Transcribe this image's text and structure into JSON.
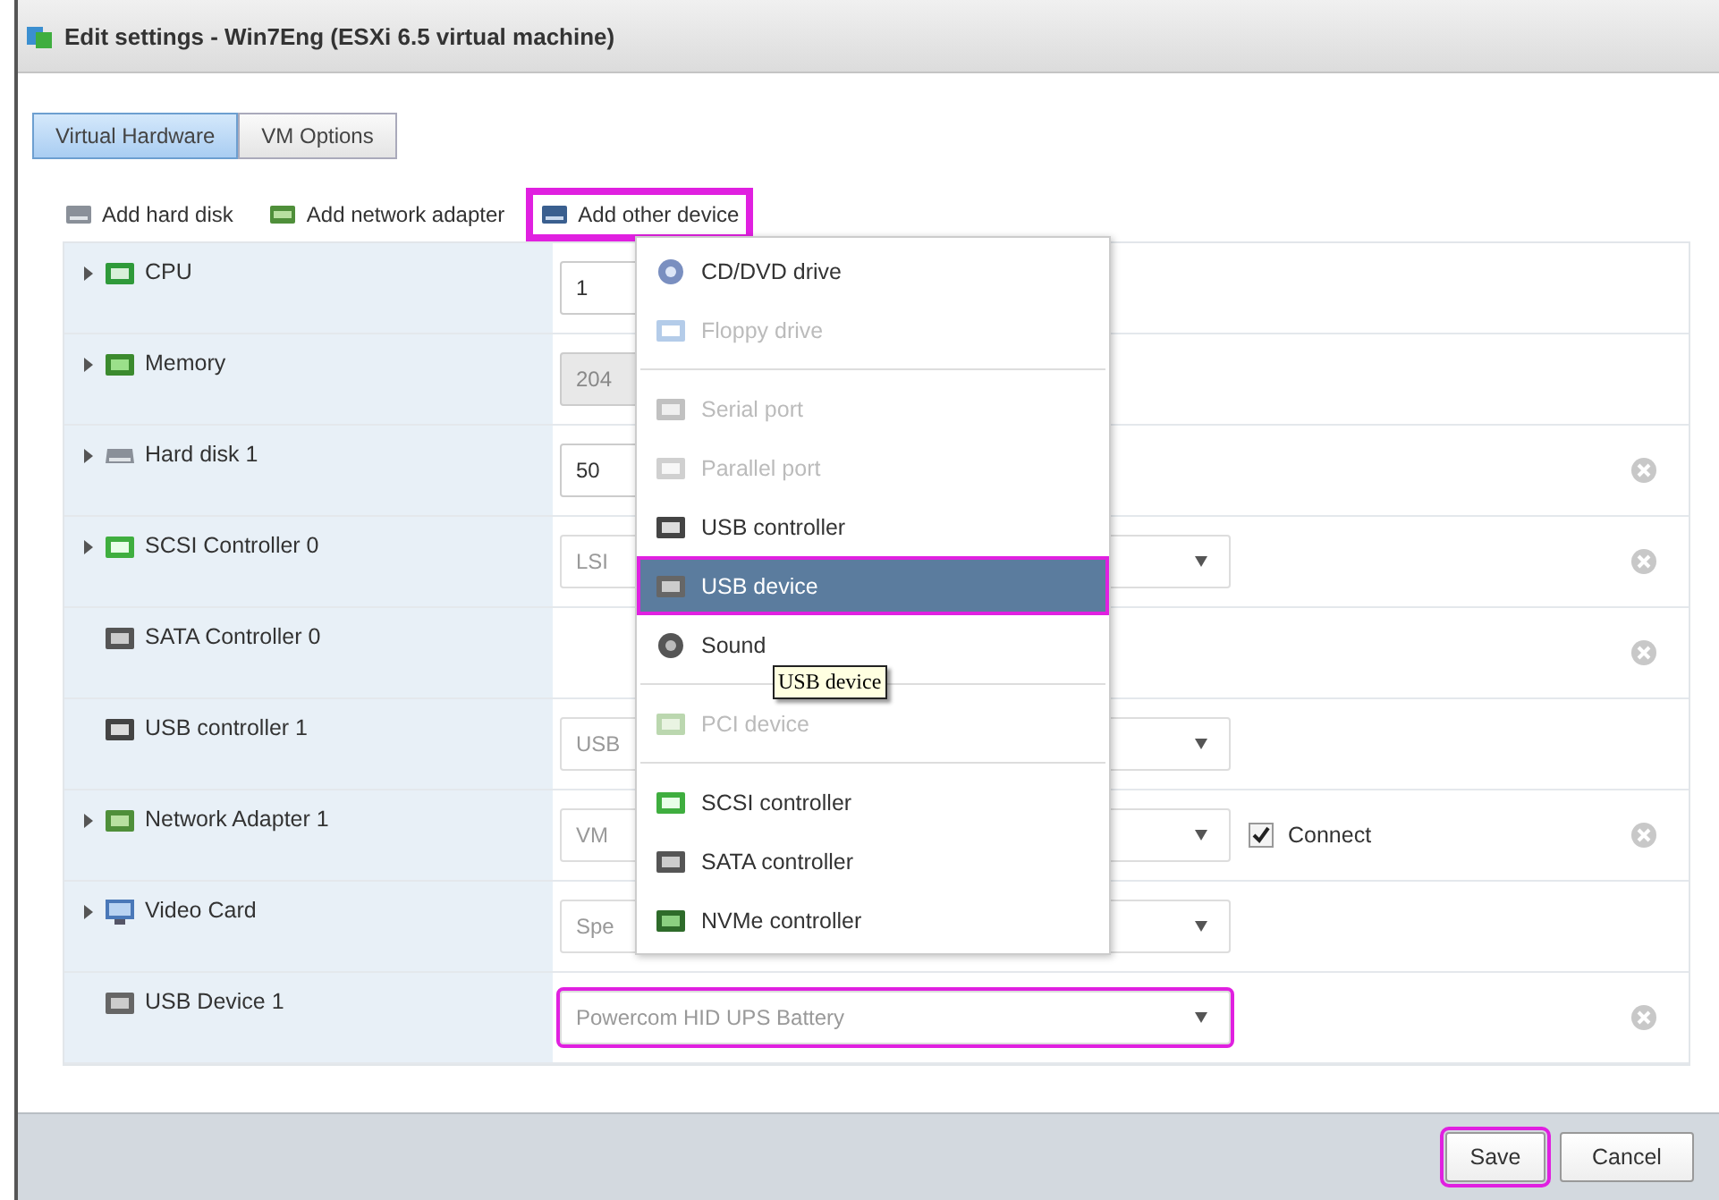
{
  "window": {
    "title": "Edit settings - Win7Eng (ESXi 6.5 virtual machine)"
  },
  "tabs": [
    {
      "label": "Virtual Hardware",
      "selected": true
    },
    {
      "label": "VM Options",
      "selected": false
    }
  ],
  "toolbar": [
    {
      "label": "Add hard disk",
      "kind": "disk",
      "highlighted": false
    },
    {
      "label": "Add network adapter",
      "kind": "network",
      "highlighted": false
    },
    {
      "label": "Add other device",
      "kind": "device",
      "highlighted": true
    }
  ],
  "devices": [
    {
      "label": "CPU",
      "kind": "cpu",
      "expandable": true,
      "field": {
        "kind": "input",
        "value": "1",
        "disabled": false,
        "highlighted": false
      },
      "removable": false
    },
    {
      "label": "Memory",
      "kind": "memory",
      "expandable": true,
      "field": {
        "kind": "input",
        "value": "204",
        "disabled": true,
        "highlighted": false
      },
      "removable": false
    },
    {
      "label": "Hard disk 1",
      "kind": "disk",
      "expandable": true,
      "field": {
        "kind": "input",
        "value": "50",
        "disabled": false,
        "highlighted": false
      },
      "removable": true
    },
    {
      "label": "SCSI Controller 0",
      "kind": "scsi",
      "expandable": true,
      "field": {
        "kind": "select",
        "value": "LSI",
        "disabled": false,
        "highlighted": false
      },
      "removable": true
    },
    {
      "label": "SATA Controller 0",
      "kind": "sata",
      "expandable": false,
      "removable": true
    },
    {
      "label": "USB controller 1",
      "kind": "usb",
      "expandable": false,
      "field": {
        "kind": "select",
        "value": "USB",
        "disabled": false,
        "highlighted": false
      },
      "removable": false
    },
    {
      "label": "Network Adapter 1",
      "kind": "network",
      "expandable": true,
      "field": {
        "kind": "select",
        "value": "VM",
        "disabled": false,
        "highlighted": false
      },
      "connect": {
        "label": "Connect",
        "checked": true
      },
      "removable": true
    },
    {
      "label": "Video Card",
      "kind": "video",
      "expandable": true,
      "field": {
        "kind": "select",
        "value": "Spe",
        "disabled": false,
        "highlighted": false
      },
      "removable": false
    },
    {
      "label": "USB Device 1",
      "kind": "usbdev",
      "expandable": false,
      "field": {
        "kind": "select",
        "value": "Powercom HID UPS Battery",
        "disabled": false,
        "highlighted": true
      },
      "removable": true
    }
  ],
  "menu": {
    "groups": [
      [
        {
          "label": "CD/DVD drive",
          "kind": "cd",
          "disabled": false,
          "selected": false
        },
        {
          "label": "Floppy drive",
          "kind": "floppy",
          "disabled": true,
          "selected": false
        }
      ],
      [
        {
          "label": "Serial port",
          "kind": "serial",
          "disabled": true,
          "selected": false
        },
        {
          "label": "Parallel port",
          "kind": "parallel",
          "disabled": true,
          "selected": false
        },
        {
          "label": "USB controller",
          "kind": "usb",
          "disabled": false,
          "selected": false
        },
        {
          "label": "USB device",
          "kind": "usbdev",
          "disabled": false,
          "selected": true
        },
        {
          "label": "Sound",
          "kind": "sound",
          "disabled": false,
          "selected": false
        }
      ],
      [
        {
          "label": "PCI device",
          "kind": "pci",
          "disabled": true,
          "selected": false
        }
      ],
      [
        {
          "label": "SCSI controller",
          "kind": "scsi",
          "disabled": false,
          "selected": false
        },
        {
          "label": "SATA controller",
          "kind": "sata",
          "disabled": false,
          "selected": false
        },
        {
          "label": "NVMe controller",
          "kind": "nvme",
          "disabled": false,
          "selected": false
        }
      ]
    ]
  },
  "tooltip": {
    "text": "USB device"
  },
  "buttons": [
    {
      "label": "Save",
      "highlighted": true
    },
    {
      "label": "Cancel",
      "highlighted": false
    }
  ]
}
